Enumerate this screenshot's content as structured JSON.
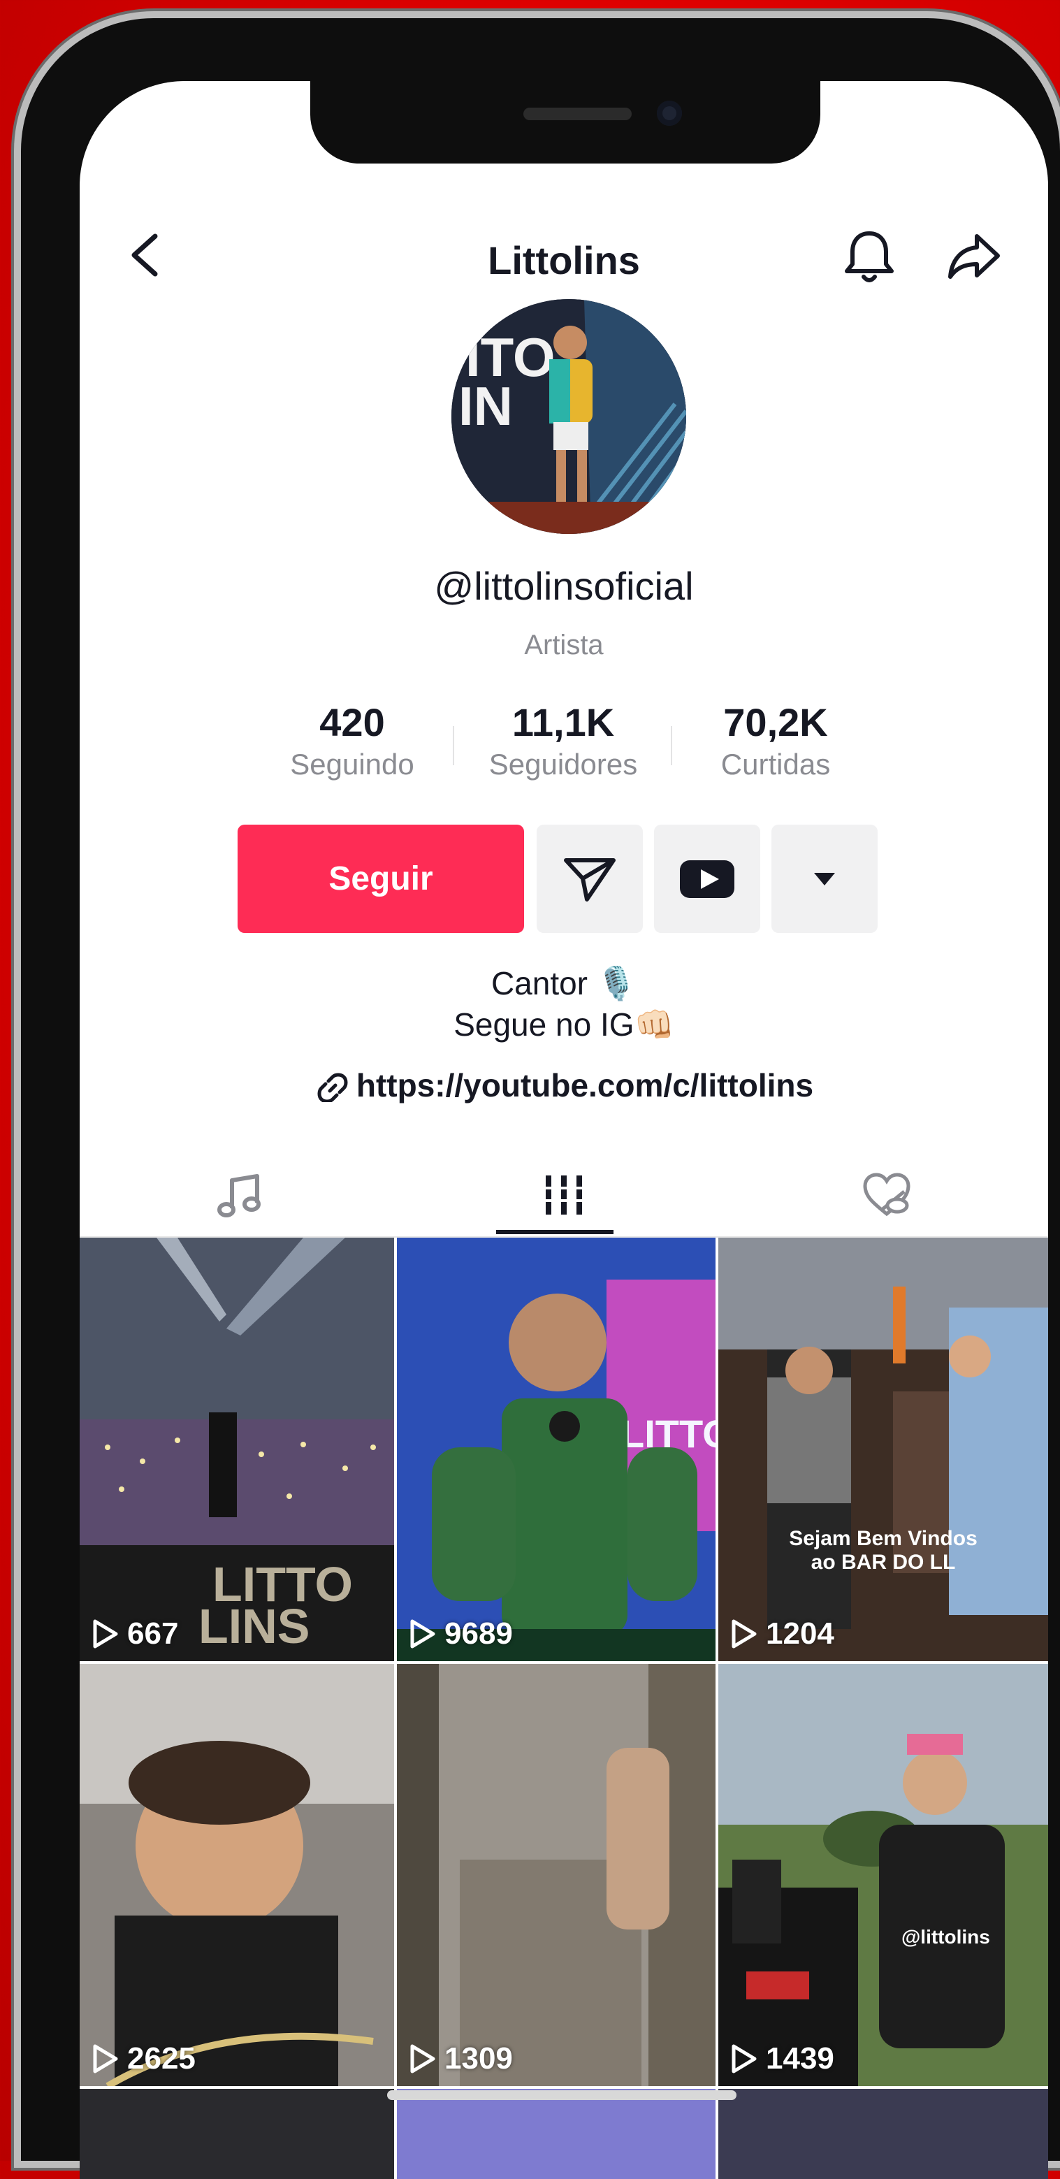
{
  "header": {
    "title": "Littolins"
  },
  "profile": {
    "handle": "@littolinsoficial",
    "category": "Artista",
    "stats": [
      {
        "value": "420",
        "label": "Seguindo"
      },
      {
        "value": "11,1K",
        "label": "Seguidores"
      },
      {
        "value": "70,2K",
        "label": "Curtidas"
      }
    ],
    "follow_label": "Seguir",
    "bio_line1": "Cantor 🎙️",
    "bio_line2": "Segue no IG👊🏻",
    "link": "https://youtube.com/c/littolins",
    "avatar_text": "ITO IN"
  },
  "tabs": [
    {
      "name": "music",
      "icon": "music-note-icon"
    },
    {
      "name": "videos",
      "icon": "grid-icon"
    },
    {
      "name": "liked",
      "icon": "hidden-heart-icon"
    }
  ],
  "videos": [
    {
      "views": "667",
      "overlay": "LITTO LINS"
    },
    {
      "views": "9689",
      "overlay": ""
    },
    {
      "views": "1204",
      "overlay": "Sejam Bem Vindos ao BAR DO LL"
    },
    {
      "views": "2625",
      "overlay": ""
    },
    {
      "views": "1309",
      "overlay": ""
    },
    {
      "views": "1439",
      "overlay": "@littolins"
    }
  ],
  "colors": {
    "accent": "#fe2c55",
    "background": "#e00000"
  }
}
